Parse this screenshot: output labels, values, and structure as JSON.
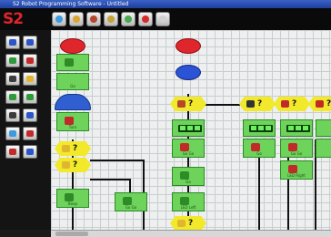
{
  "window": {
    "title": "S2 Robot Programming Software - Untitled"
  },
  "toolbar": {
    "logo": "S2",
    "buttons": [
      {
        "icon": "new-file-icon",
        "color": "#3a9be0"
      },
      {
        "icon": "open-folder-icon",
        "color": "#d9a533"
      },
      {
        "icon": "save-icon",
        "color": "#b5472b"
      },
      {
        "icon": "undo-icon",
        "color": "#c5a23b"
      },
      {
        "icon": "download-icon",
        "color": "#4aa84f"
      },
      {
        "icon": "stop-icon",
        "color": "#d42a2a"
      },
      {
        "icon": "help-icon",
        "color": "#d0d0d0"
      }
    ]
  },
  "palette": {
    "buttons": [
      {
        "icon": "motor-left-icon",
        "color": "#2b55c9"
      },
      {
        "icon": "motor-right-icon",
        "color": "#2b55c9"
      },
      {
        "icon": "led-icon",
        "color": "#2f9a3a"
      },
      {
        "icon": "speaker-icon",
        "color": "#c52a2a"
      },
      {
        "icon": "pen-icon",
        "color": "#3c3c3c"
      },
      {
        "icon": "light-sensor-icon",
        "color": "#e0b630"
      },
      {
        "icon": "line-sensor-icon",
        "color": "#2f9a3a"
      },
      {
        "icon": "obstacle-sensor-icon",
        "color": "#2f9a3a"
      },
      {
        "icon": "timer-icon",
        "color": "#3c3c3c"
      },
      {
        "icon": "loop-icon",
        "color": "#2b55c9"
      },
      {
        "icon": "variable-icon",
        "color": "#3a9be0"
      },
      {
        "icon": "random-icon",
        "color": "#c52a2a"
      },
      {
        "icon": "stop-program-icon",
        "color": "#c52a2a"
      },
      {
        "icon": "start-program-icon",
        "color": "#2b55c9"
      }
    ]
  },
  "flow": {
    "colors": {
      "action": "#6dd35a",
      "decision": "#f1e92a",
      "start": "#2b53d6",
      "stop": "#e0262d",
      "wire": "#111111"
    },
    "blocks": [
      {
        "label": "Go"
      },
      {
        "label": "Turn"
      },
      {
        "label": "Beep"
      },
      {
        "label": "Go Go"
      },
      {
        "label": "Go Go"
      },
      {
        "label": "Go"
      },
      {
        "label": "LED Left"
      },
      {
        "label": "Go"
      },
      {
        "label": "Go Go"
      },
      {
        "label": "LED Right"
      },
      {
        "label": "Go Go"
      },
      {
        "label": "Go Go"
      }
    ]
  }
}
